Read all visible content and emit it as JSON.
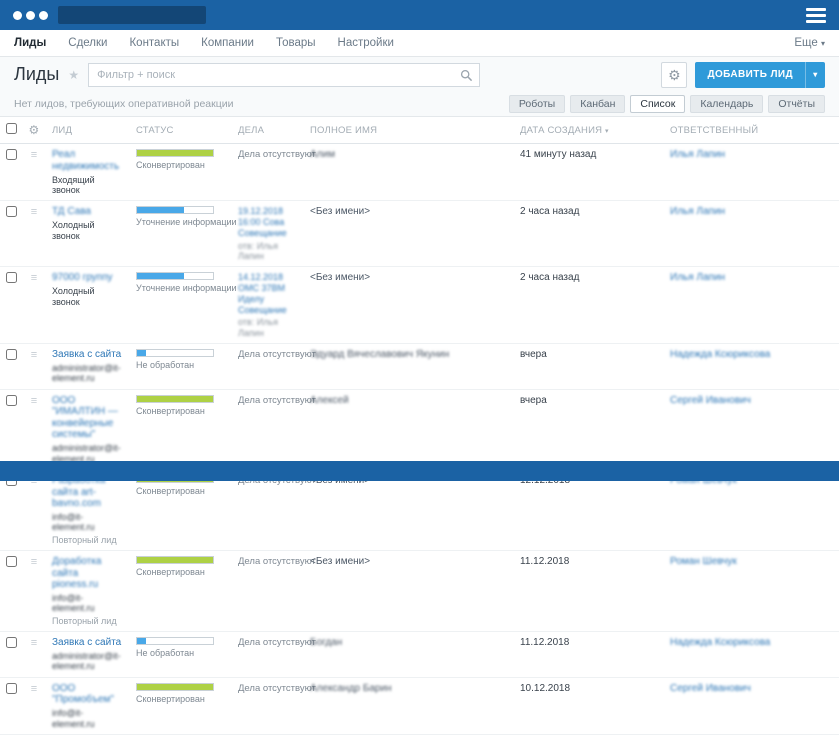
{
  "colors": {
    "header_bg": "#1b62a4",
    "accent_button": "#2f9ad9",
    "link_blue": "#2e77b6",
    "status_green": "#aed145",
    "status_blue": "#49a8e8"
  },
  "nav": {
    "items": [
      {
        "label": "Лиды",
        "active": true
      },
      {
        "label": "Сделки",
        "active": false
      },
      {
        "label": "Контакты",
        "active": false
      },
      {
        "label": "Компании",
        "active": false
      },
      {
        "label": "Товары",
        "active": false
      },
      {
        "label": "Настройки",
        "active": false
      }
    ],
    "more": "Еще"
  },
  "toolbar": {
    "title": "Лиды",
    "filter_placeholder": "Фильтр + поиск",
    "add_label": "ДОБАВИТЬ ЛИД"
  },
  "viewbar": {
    "notice": "Нет лидов, требующих оперативной реакции",
    "views": [
      {
        "label": "Роботы",
        "active": false
      },
      {
        "label": "Канбан",
        "active": false
      },
      {
        "label": "Список",
        "active": true
      },
      {
        "label": "Календарь",
        "active": false
      },
      {
        "label": "Отчёты",
        "active": false
      }
    ]
  },
  "table": {
    "columns": [
      "ЛИД",
      "СТАТУС",
      "ДЕЛА",
      "ПОЛНОЕ ИМЯ",
      "ДАТА СОЗДАНИЯ",
      "ОТВЕТСТВЕННЫЙ"
    ],
    "sorted_column": "ДАТА СОЗДАНИЯ",
    "no_activity_text": "Дела отсутствуют",
    "rows": [
      {
        "title": "Реал недвижимость",
        "title_blur": true,
        "subtitle": "Входящий звонок",
        "subtitle_blur": false,
        "status": {
          "label": "Сконвертирован",
          "percent": 100,
          "color": "green"
        },
        "name": "Алим",
        "name_blur": true,
        "created": "41 минуту назад",
        "responsible": "Илья Лапин"
      },
      {
        "title": "ТД Сава",
        "title_blur": true,
        "subtitle": "Холодный звонок",
        "subtitle_blur": false,
        "status": {
          "label": "Уточнение информации",
          "percent": 62,
          "color": "blue"
        },
        "activity_lines": [
          "19.12.2018 16:00 Сова",
          "Совещание"
        ],
        "activity_owner": "отв: Илья Лапин",
        "name": "<Без имени>",
        "name_blur": false,
        "created": "2 часа назад",
        "responsible": "Илья Лапин"
      },
      {
        "title": "97000 группу",
        "title_blur": true,
        "subtitle": "Холодный звонок",
        "subtitle_blur": false,
        "status": {
          "label": "Уточнение информации",
          "percent": 62,
          "color": "blue"
        },
        "activity_lines": [
          "14.12.2018 ОМС 37ВМ",
          "Иделу Совещание"
        ],
        "activity_owner": "отв: Илья Лапин",
        "name": "<Без имени>",
        "name_blur": false,
        "created": "2 часа назад",
        "responsible": "Илья Лапин"
      },
      {
        "title": "Заявка с сайта",
        "title_blur": false,
        "subtitle": "administrator@it-element.ru",
        "subtitle_blur": true,
        "status": {
          "label": "Не обработан",
          "percent": 12,
          "color": "blue"
        },
        "name": "Эдуард Вячеславович Якунин",
        "name_blur": true,
        "created": "вчера",
        "responsible": "Надежда Ксюриксова"
      },
      {
        "title": "ООО \"ИМАЛТИН — конвейерные системы\"",
        "title_blur": true,
        "subtitle": "administrator@it-element.ru",
        "subtitle_blur": true,
        "status": {
          "label": "Сконвертирован",
          "percent": 100,
          "color": "green"
        },
        "name": "Алексей",
        "name_blur": true,
        "created": "вчера",
        "responsible": "Сергей Иванович"
      },
      {
        "title": "Разработка сайта art-bavno.com",
        "title_blur": true,
        "subtitle": "info@it-element.ru",
        "subtitle_blur": true,
        "note": "Повторный лид",
        "status": {
          "label": "Сконвертирован",
          "percent": 100,
          "color": "green"
        },
        "name": "<Без имени>",
        "name_blur": false,
        "created": "12.12.2018",
        "responsible": "Роман Шевчук"
      },
      {
        "title": "Доработка сайта pioness.ru",
        "title_blur": true,
        "subtitle": "info@it-element.ru",
        "subtitle_blur": true,
        "note": "Повторный лид",
        "status": {
          "label": "Сконвертирован",
          "percent": 100,
          "color": "green"
        },
        "name": "<Без имени>",
        "name_blur": false,
        "created": "11.12.2018",
        "responsible": "Роман Шевчук"
      },
      {
        "title": "Заявка с сайта",
        "title_blur": false,
        "subtitle": "administrator@it-element.ru",
        "subtitle_blur": true,
        "status": {
          "label": "Не обработан",
          "percent": 12,
          "color": "blue"
        },
        "name": "Богдан",
        "name_blur": true,
        "created": "11.12.2018",
        "responsible": "Надежда Ксюриксова"
      },
      {
        "title": "ООО \"Промобъем\"",
        "title_blur": true,
        "subtitle": "info@it-element.ru",
        "subtitle_blur": true,
        "status": {
          "label": "Сконвертирован",
          "percent": 100,
          "color": "green"
        },
        "name": "Александр Барин",
        "name_blur": true,
        "created": "10.12.2018",
        "responsible": "Сергей Иванович"
      }
    ]
  }
}
